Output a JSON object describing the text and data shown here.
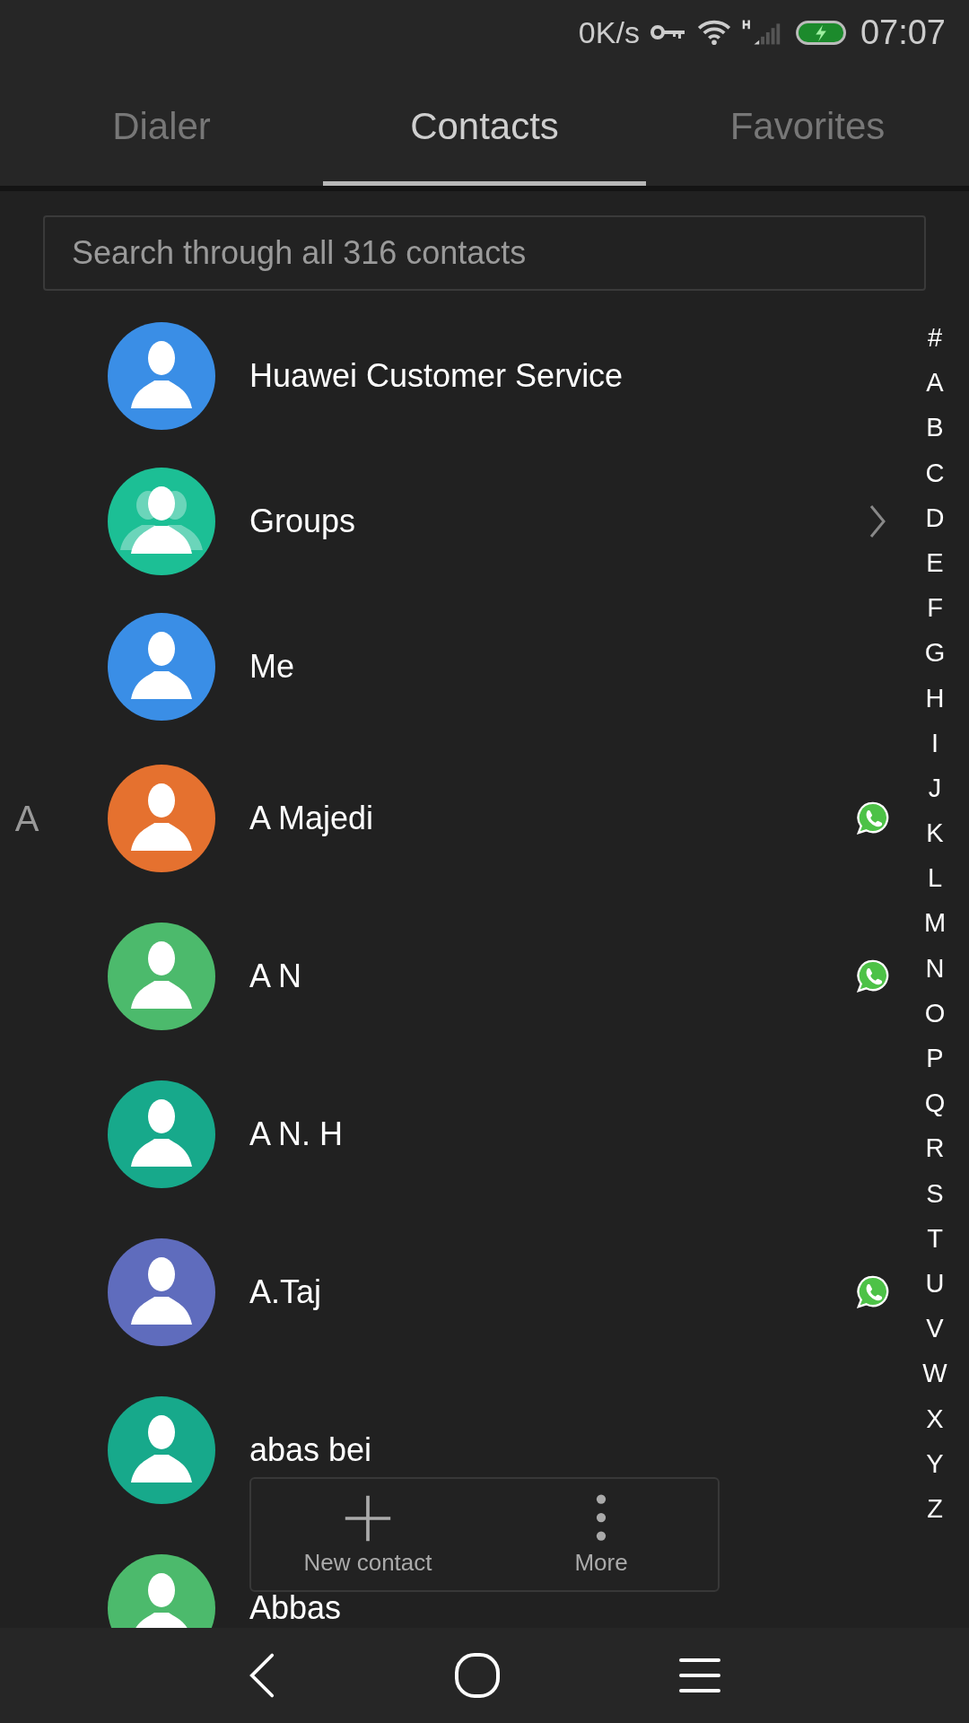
{
  "status_bar": {
    "network_speed": "0K/s",
    "time": "07:07"
  },
  "tabs": [
    {
      "label": "Dialer",
      "selected": false
    },
    {
      "label": "Contacts",
      "selected": true
    },
    {
      "label": "Favorites",
      "selected": false
    }
  ],
  "search": {
    "placeholder": "Search through all 316 contacts"
  },
  "contacts": [
    {
      "kind": "entry",
      "name": "Huawei Customer Service",
      "color": "#3a8ee6",
      "whatsapp": false
    },
    {
      "kind": "groups",
      "name": "Groups",
      "color": "#1cbf95",
      "whatsapp": false
    },
    {
      "kind": "entry",
      "name": "Me",
      "color": "#3a8ee6",
      "whatsapp": false
    },
    {
      "kind": "contact",
      "section": "A",
      "name": "A Majedi",
      "color": "#e5712f",
      "whatsapp": true
    },
    {
      "kind": "contact",
      "name": "A N",
      "color": "#4cba6c",
      "whatsapp": true
    },
    {
      "kind": "contact",
      "name": "A N. H",
      "color": "#17a98b",
      "whatsapp": false
    },
    {
      "kind": "contact",
      "name": "A.Taj",
      "color": "#5f6cbd",
      "whatsapp": true
    },
    {
      "kind": "contact",
      "name": "abas bei",
      "color": "#17a98b",
      "whatsapp": false
    },
    {
      "kind": "contact",
      "name": "Abbas",
      "color": "#4cba6c",
      "whatsapp": false
    }
  ],
  "index": [
    "#",
    "A",
    "B",
    "C",
    "D",
    "E",
    "F",
    "G",
    "H",
    "I",
    "J",
    "K",
    "L",
    "M",
    "N",
    "O",
    "P",
    "Q",
    "R",
    "S",
    "T",
    "U",
    "V",
    "W",
    "X",
    "Y",
    "Z"
  ],
  "actions": [
    {
      "kind": "add",
      "label": "New contact"
    },
    {
      "kind": "more",
      "label": "More"
    }
  ]
}
